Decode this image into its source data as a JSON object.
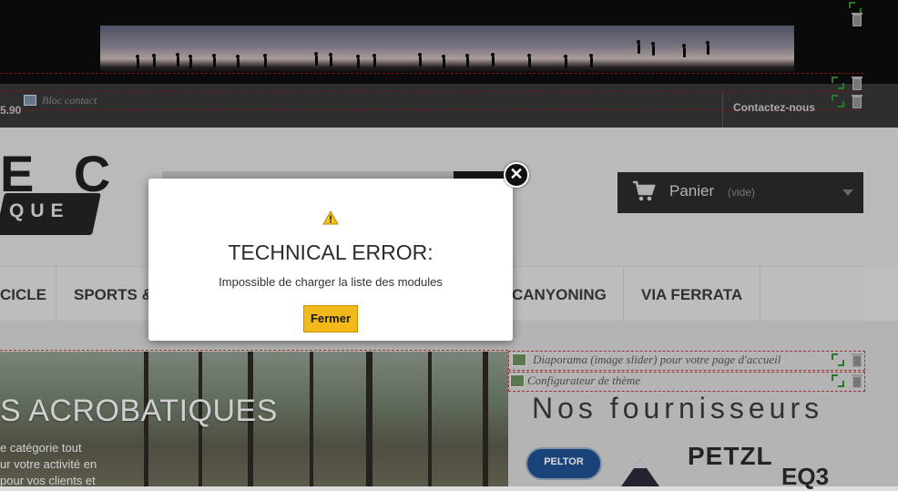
{
  "topbar": {
    "phone": "5.90",
    "bloc_contact": "Bloc contact",
    "contact_link": "Contactez-nous"
  },
  "header": {
    "logo_text": "E C",
    "logo_sub": "QUE",
    "cart_label": "Panier",
    "cart_empty": "(vide)"
  },
  "menu": {
    "items": [
      "CICLE",
      "SPORTS &",
      "CANYONING",
      "VIA FERRATA"
    ]
  },
  "content": {
    "slide_title": "S ACROBATIQUES",
    "slide_lines": [
      "e catégorie tout",
      "ur votre activité en",
      "pour vos clients et"
    ],
    "modules": [
      "Diaporama (image slider) pour votre page d'accueil",
      "Configurateur de thème"
    ],
    "suppliers_title": "Nos fournisseurs",
    "brands": [
      "PELTOR",
      "PETZL",
      "EQ3"
    ]
  },
  "modal": {
    "title": "TECHNICAL ERROR:",
    "message": "Impossible de charger la liste des modules",
    "close_label": "Fermer",
    "close_x": "✕"
  },
  "colors": {
    "accent_button": "#f3b81a",
    "dark_bar": "#2b2b2b",
    "module_border": "#b0403f"
  },
  "icons": {
    "warning": "warning-icon",
    "close": "close-icon",
    "cart": "cart-icon",
    "move": "move-icon",
    "trash": "trash-icon"
  }
}
